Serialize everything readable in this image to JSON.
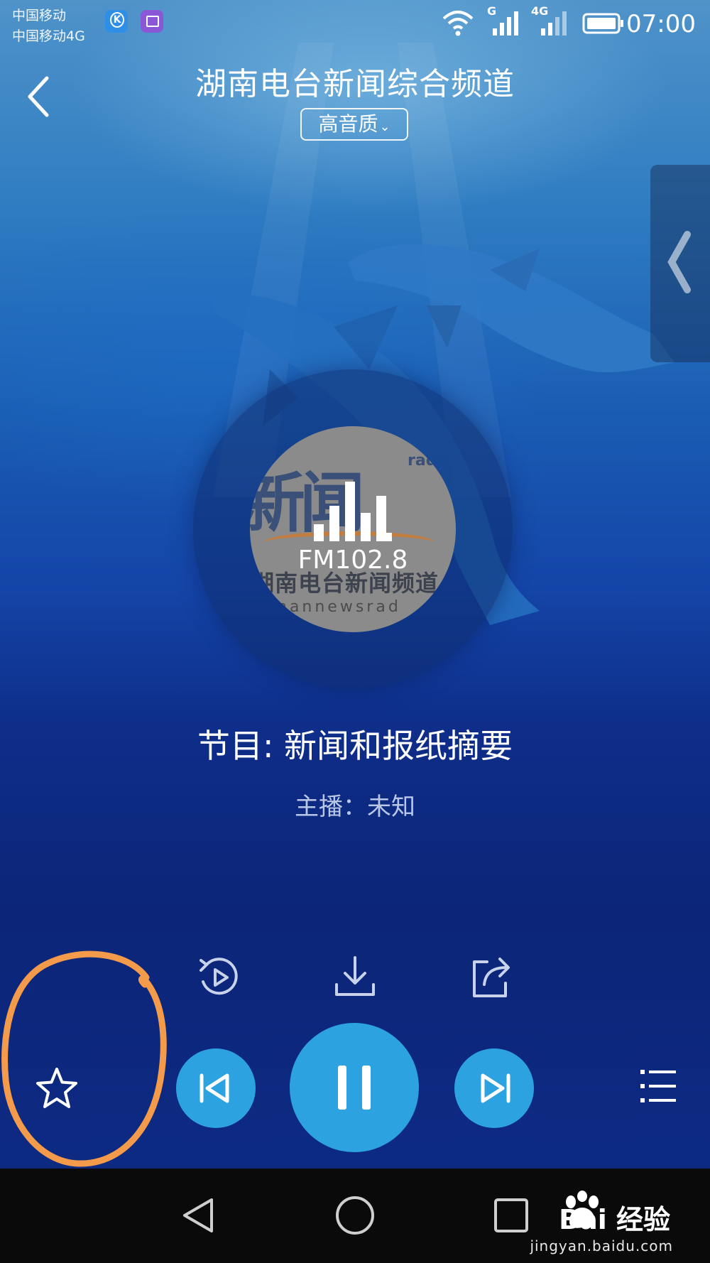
{
  "status_bar": {
    "carrier_1": "中国移动",
    "carrier_2": "中国移动4G",
    "network_1": "G",
    "network_2": "4G",
    "time": "07:00"
  },
  "header": {
    "title": "湖南电台新闻综合频道",
    "quality_label": "高音质",
    "quality_chevron": "⌄"
  },
  "station_logo": {
    "word": "新闻",
    "corner_text": "radi",
    "cn_name": "湖南电台新闻频道",
    "en_name": "nannewsrad",
    "frequency": "FM102.8"
  },
  "program": {
    "title": "节目: 新闻和报纸摘要",
    "host": "主播：未知"
  },
  "actions": [
    "replay-icon",
    "download-icon",
    "share-icon"
  ],
  "controls": [
    "favorite-star-icon",
    "previous-icon",
    "pause-icon",
    "next-icon",
    "playlist-icon"
  ],
  "watermark": {
    "brand": "Bai 经验",
    "url": "jingyan.baidu.com"
  },
  "colors": {
    "control_blue": "#2ca3e0",
    "annotation_orange": "#f39b4a",
    "navbar": "#0a0a0a"
  }
}
